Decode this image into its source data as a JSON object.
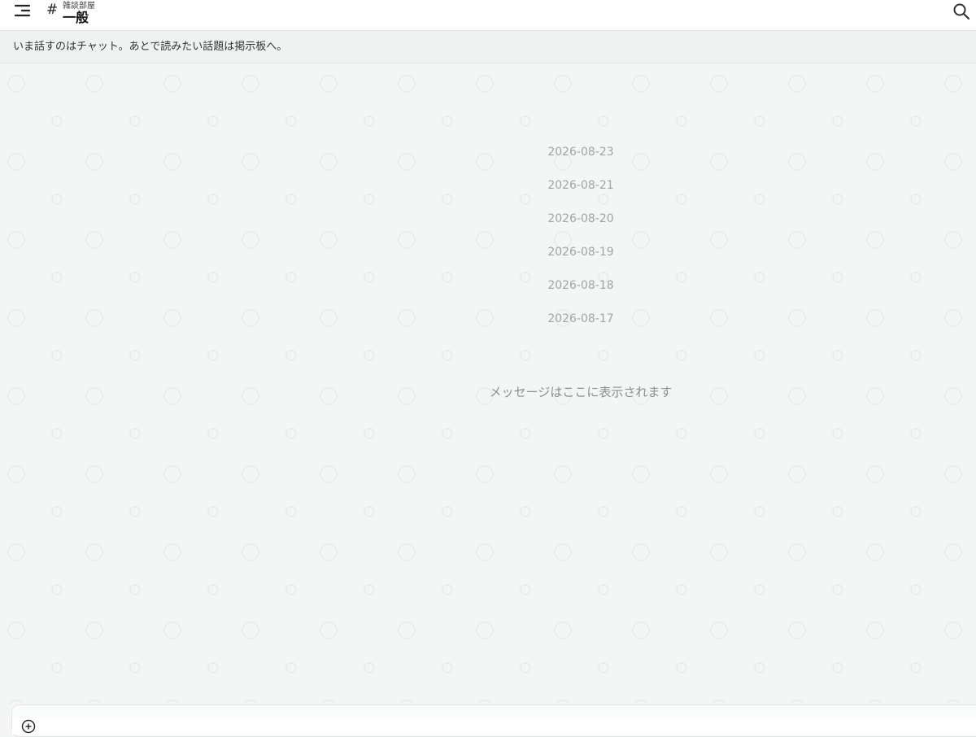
{
  "header": {
    "channel_prefix": "#",
    "room_name": "雑談部屋",
    "channel_name": "一般"
  },
  "banner": {
    "text": "いま話すのはチャット。あとで読みたい話題は掲示板へ。"
  },
  "chat": {
    "dates": [
      "2026-08-23",
      "2026-08-21",
      "2026-08-20",
      "2026-08-19",
      "2026-08-18",
      "2026-08-17"
    ],
    "empty_message": "メッセージはここに表示されます"
  },
  "icons": {
    "menu": "menu-icon",
    "search": "search-icon",
    "add": "plus-circle-icon"
  },
  "colors": {
    "header_bg": "#ffffff",
    "banner_bg": "#eef3f2",
    "chat_bg": "#f4f6f5"
  }
}
